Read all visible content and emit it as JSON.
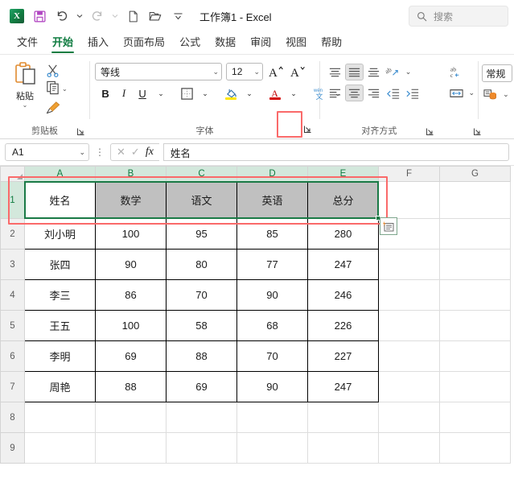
{
  "titlebar": {
    "app_icon": "excel-icon",
    "app_icon_letter": "X",
    "document_title": "工作簿1  -  Excel",
    "quick_access": [
      {
        "name": "save-icon",
        "label": "保存"
      },
      {
        "name": "undo-icon",
        "label": "撤消"
      },
      {
        "name": "redo-icon",
        "label": "恢复"
      },
      {
        "name": "new-icon",
        "label": "新建"
      },
      {
        "name": "open-icon",
        "label": "打开"
      },
      {
        "name": "customize-qat-icon",
        "label": "自定义快速访问工具栏"
      }
    ],
    "search_placeholder": "搜索"
  },
  "tabs": [
    {
      "label": "文件",
      "active": false
    },
    {
      "label": "开始",
      "active": true
    },
    {
      "label": "插入",
      "active": false
    },
    {
      "label": "页面布局",
      "active": false
    },
    {
      "label": "公式",
      "active": false
    },
    {
      "label": "数据",
      "active": false
    },
    {
      "label": "审阅",
      "active": false
    },
    {
      "label": "视图",
      "active": false
    },
    {
      "label": "帮助",
      "active": false
    }
  ],
  "ribbon": {
    "clipboard": {
      "group_label": "剪贴板",
      "paste_label": "粘贴",
      "cut_label": "剪切",
      "copy_label": "复制",
      "format_painter_label": "格式刷",
      "launcher_label": "剪贴板对话框启动器"
    },
    "font": {
      "group_label": "字体",
      "font_name": "等线",
      "font_size": "12",
      "grow_font": "A",
      "shrink_font": "A",
      "bold": "B",
      "italic": "I",
      "underline": "U",
      "borders_label": "边框",
      "fill_color_label": "填充颜色",
      "font_color_label": "字体颜色",
      "phonetic_label": "拼音指南",
      "launcher_label": "字体对话框启动器",
      "launcher_highlighted": true
    },
    "alignment": {
      "group_label": "对齐方式",
      "top_align": "顶端对齐",
      "middle_align": "垂直居中",
      "bottom_align": "底端对齐",
      "orientation": "方向",
      "left_align": "左对齐",
      "center_align": "居中",
      "right_align": "右对齐",
      "decrease_indent": "减少缩进量",
      "increase_indent": "增加缩进量",
      "wrap_text": "自动换行",
      "merge_center": "合并后居中",
      "launcher_label": "对齐方式对话框启动器"
    },
    "number": {
      "format_value": "常规",
      "launcher_label": "数字对话框启动器"
    }
  },
  "formula_bar": {
    "name_box_value": "A1",
    "cancel_icon": "✕",
    "enter_icon": "✓",
    "fx_icon": "fx",
    "formula_value": "姓名"
  },
  "sheet": {
    "columns": [
      "A",
      "B",
      "C",
      "D",
      "E",
      "F",
      "G"
    ],
    "selected_columns": [
      "A",
      "B",
      "C",
      "D",
      "E"
    ],
    "rows": [
      "1",
      "2",
      "3",
      "4",
      "5",
      "6",
      "7",
      "8",
      "9"
    ],
    "selected_rows": [
      "1"
    ],
    "header_row": [
      "姓名",
      "数学",
      "语文",
      "英语",
      "总分"
    ],
    "data_rows": [
      [
        "刘小明",
        "100",
        "95",
        "85",
        "280"
      ],
      [
        "张四",
        "90",
        "80",
        "77",
        "247"
      ],
      [
        "李三",
        "86",
        "70",
        "90",
        "246"
      ],
      [
        "王五",
        "100",
        "58",
        "68",
        "226"
      ],
      [
        "李明",
        "69",
        "88",
        "70",
        "227"
      ],
      [
        "周艳",
        "88",
        "69",
        "90",
        "247"
      ]
    ],
    "selection_range": "A1:E1",
    "paste_options_label": "粘贴选项",
    "annotation_color": "#fa6a6a",
    "selection_color": "#1a7a46"
  }
}
